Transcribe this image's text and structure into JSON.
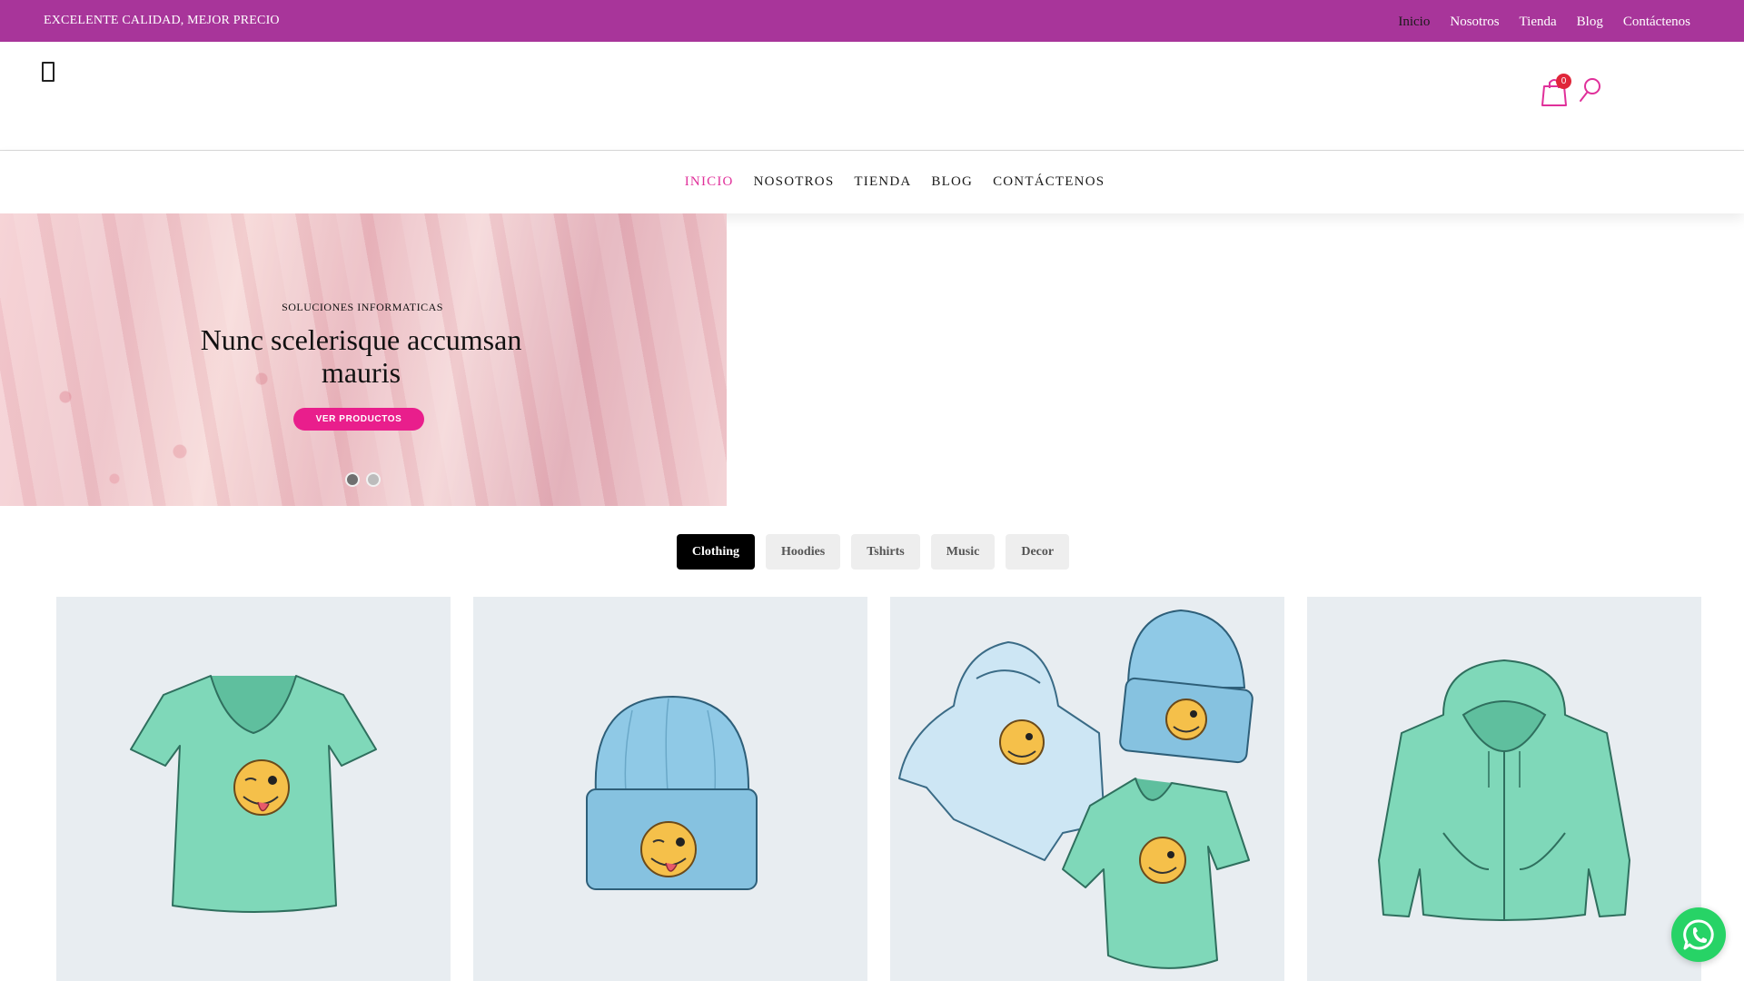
{
  "topbar": {
    "tagline": "EXCELENTE CALIDAD, MEJOR PRECIO",
    "links": [
      "Inicio",
      "Nosotros",
      "Tienda",
      "Blog",
      "Contáctenos"
    ],
    "active_index": 0
  },
  "header": {
    "menu_icon": "menu-icon",
    "cart_icon": "shopping-bag-icon",
    "cart_count": "0",
    "search_icon": "search-icon"
  },
  "main_nav": {
    "items": [
      "INICIO",
      "NOSOTROS",
      "TIENDA",
      "BLOG",
      "CONTÁCTENOS"
    ],
    "active_index": 0
  },
  "hero": {
    "kicker": "SOLUCIONES INFORMATICAS",
    "headline": "Nunc scelerisque accumsan mauris",
    "cta_label": "VER PRODUCTOS",
    "slide_count": 2,
    "active_slide": 0
  },
  "tabs": {
    "items": [
      "Clothing",
      "Hoodies",
      "Tshirts",
      "Music",
      "Decor"
    ],
    "active_index": 0
  },
  "products": [
    {
      "image": "v-neck-tshirt-winking-emoji-image"
    },
    {
      "image": "beanie-winking-emoji-image"
    },
    {
      "image": "hoodie-beanie-tshirt-bundle-image"
    },
    {
      "image": "zip-hoodie-image"
    }
  ],
  "colors": {
    "topbar_bg": "#a8359a",
    "accent_pink": "#e91e8c",
    "nav_active": "#e0309a",
    "cart_badge": "#e0263a",
    "product_bg": "#e8edf1",
    "mint": "#7fd8b9",
    "sky": "#8fc9e6",
    "whatsapp": "#27d366"
  },
  "whatsapp": {
    "icon": "whatsapp-icon"
  }
}
